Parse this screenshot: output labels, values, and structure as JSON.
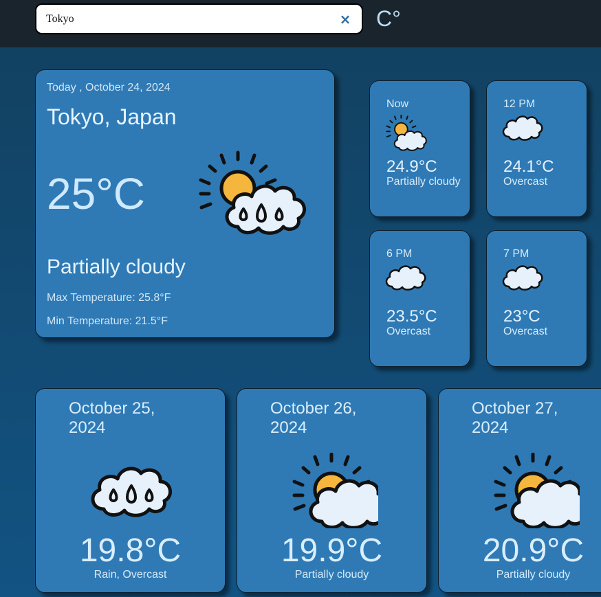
{
  "search": {
    "value": "Tokyo",
    "clear_label": "×"
  },
  "unit_toggle": "C°",
  "today": {
    "date": "Today , October 24, 2024",
    "location": "Tokyo, Japan",
    "temperature": "25°C",
    "condition": "Partially cloudy",
    "max_temp": "Max Temperature: 25.8°F",
    "min_temp": "Min Temperature: 21.5°F",
    "icon": "sun-cloud-rain-icon"
  },
  "hourly": [
    {
      "time": "Now",
      "temp": "24.9°C",
      "condition": "Partially cloudy",
      "icon": "partly-cloudy-icon"
    },
    {
      "time": "12 PM",
      "temp": "24.1°C",
      "condition": "Overcast",
      "icon": "cloud-icon"
    },
    {
      "time": "6 PM",
      "temp": "23.5°C",
      "condition": "Overcast",
      "icon": "cloud-icon"
    },
    {
      "time": "7 PM",
      "temp": "23°C",
      "condition": "Overcast",
      "icon": "cloud-icon"
    }
  ],
  "daily": [
    {
      "date": "October 25, 2024",
      "temp": "19.8°C",
      "condition": "Rain, Overcast",
      "icon": "rain-cloud-icon"
    },
    {
      "date": "October 26, 2024",
      "temp": "19.9°C",
      "condition": "Partially cloudy",
      "icon": "partly-cloudy-icon"
    },
    {
      "date": "October 27, 2024",
      "temp": "20.9°C",
      "condition": "Partially cloudy",
      "icon": "partly-cloudy-icon"
    }
  ],
  "colors": {
    "topbar": "#1a242d",
    "background": "#12405f",
    "card": "#2f7ab5",
    "sun": "#f4b63c",
    "cloud": "#e6f1fb"
  }
}
